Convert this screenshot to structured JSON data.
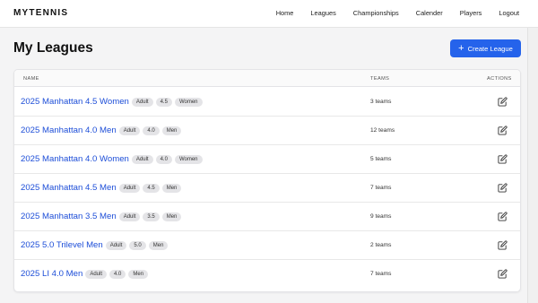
{
  "header": {
    "brand": "MYTENNIS",
    "nav": [
      "Home",
      "Leagues",
      "Championships",
      "Calender",
      "Players",
      "Logout"
    ]
  },
  "page": {
    "title": "My Leagues",
    "create_label": "Create League"
  },
  "table": {
    "columns": [
      "NAME",
      "TEAMS",
      "ACTIONS"
    ],
    "rows": [
      {
        "name": "2025 Manhattan 4.5 Women",
        "tags": [
          "Adult",
          "4.5",
          "Women"
        ],
        "teams": "3 teams"
      },
      {
        "name": "2025 Manhattan 4.0 Men",
        "tags": [
          "Adult",
          "4.0",
          "Men"
        ],
        "teams": "12 teams"
      },
      {
        "name": "2025 Manhattan 4.0 Women",
        "tags": [
          "Adult",
          "4.0",
          "Women"
        ],
        "teams": "5 teams"
      },
      {
        "name": "2025 Manhattan 4.5 Men",
        "tags": [
          "Adult",
          "4.5",
          "Men"
        ],
        "teams": "7 teams"
      },
      {
        "name": "2025 Manhattan 3.5 Men",
        "tags": [
          "Adult",
          "3.5",
          "Men"
        ],
        "teams": "9 teams"
      },
      {
        "name": "2025 5.0 Trilevel Men",
        "tags": [
          "Adult",
          "5.0",
          "Men"
        ],
        "teams": "2 teams"
      },
      {
        "name": "2025 LI 4.0 Men",
        "tags": [
          "Adult",
          "4.0",
          "Men"
        ],
        "teams": "7 teams"
      }
    ]
  },
  "colors": {
    "accent": "#2563eb",
    "link": "#1d4ed8",
    "tag_bg": "#e4e4e7"
  },
  "icons": {
    "create": "plus-icon",
    "row_action": "edit-icon"
  }
}
